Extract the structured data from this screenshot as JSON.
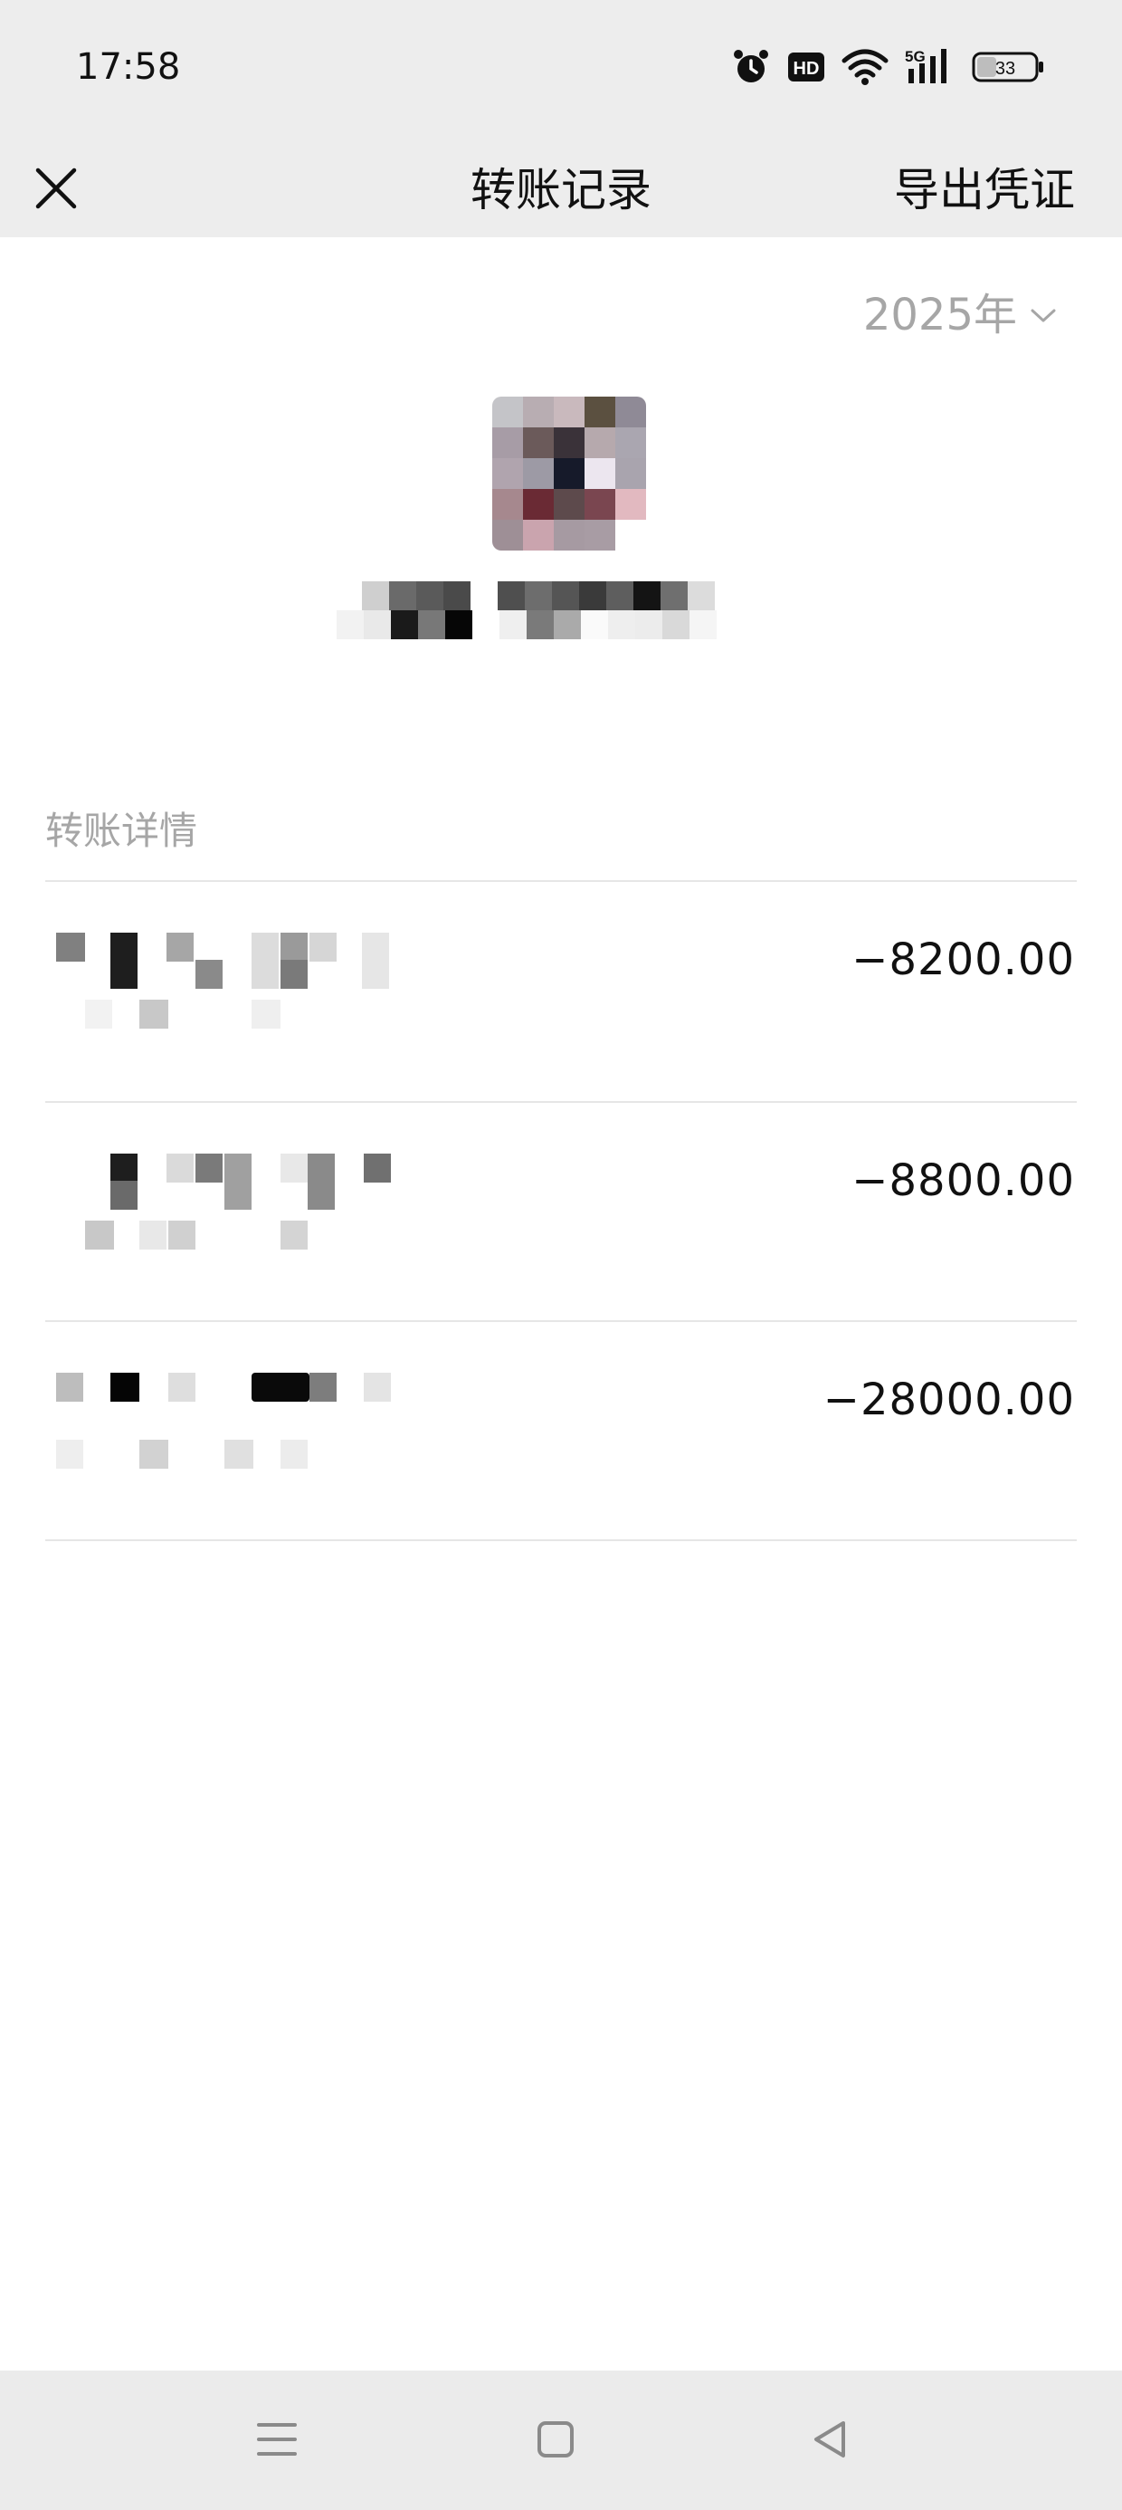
{
  "status_bar": {
    "time": "17:58",
    "icons": [
      "alarm-icon",
      "hd-icon",
      "wifi-icon",
      "signal-5g-icon",
      "battery-icon"
    ],
    "hd_label": "HD",
    "network_label": "5G",
    "battery_level": "33"
  },
  "header": {
    "title": "转账记录",
    "export_label": "导出凭证",
    "close_icon": "close-icon"
  },
  "filter": {
    "year_label": "2025年",
    "chevron_icon": "chevron-down-icon"
  },
  "contact": {
    "avatar_icon": "avatar-pixelated"
  },
  "section": {
    "title": "转账详情"
  },
  "transactions": [
    {
      "amount": "−8200.00"
    },
    {
      "amount": "−8800.00"
    },
    {
      "amount": "−28000.00"
    }
  ],
  "system_nav": {
    "icons": [
      "menu-icon",
      "home-icon",
      "back-icon"
    ]
  },
  "colors": {
    "bar_background": "#ededed",
    "secondary_text": "#a6a6a6",
    "divider": "#e6e6e6",
    "primary_text": "#111111"
  }
}
